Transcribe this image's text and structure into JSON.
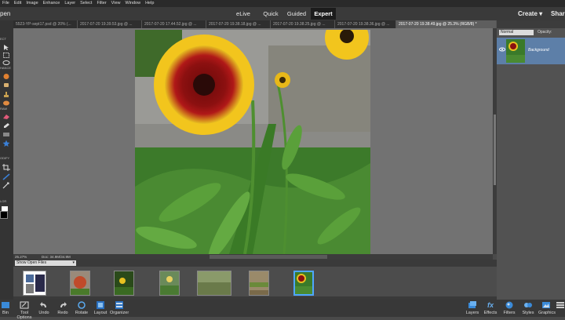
{
  "menu": {
    "items": [
      "File",
      "Edit",
      "Image",
      "Enhance",
      "Layer",
      "Select",
      "Filter",
      "View",
      "Window",
      "Help"
    ]
  },
  "modebar": {
    "open_label": "pen",
    "tabs": [
      "eLive",
      "Quick",
      "Guided",
      "Expert"
    ],
    "active_tab": "Expert",
    "create_label": "Create",
    "share_label": "Share"
  },
  "doc_tabs": [
    {
      "label": "5523-YP-sept17.psd @ 20% (..."
    },
    {
      "label": "2017-07-20 19.39.53.jpg @ ..."
    },
    {
      "label": "2017-07-20 17.44.52.jpg @ ..."
    },
    {
      "label": "2017-07-20 19.38.18.jpg @ ..."
    },
    {
      "label": "2017-07-20 19.38.25.jpg @ ..."
    },
    {
      "label": "2017-07-20 19.38.36.jpg @ ..."
    },
    {
      "label": "2017-07-20 19.38.49.jpg @ 25.3% (RGB/8) *"
    }
  ],
  "toolbar": {
    "sections": [
      "ECT",
      "HANCE",
      "RAW",
      "ODIFY",
      "LOR"
    ]
  },
  "status": {
    "zoom": "25.27%",
    "doc": "Doc: 34.9M/34.9M"
  },
  "photo_bin": {
    "dropdown_label": "Show Open Files",
    "thumb_count": 7,
    "selected_index": 6
  },
  "layers_panel": {
    "blend_mode": "Normal",
    "opacity_label": "Opacity:",
    "layer_name": "Background"
  },
  "bottom_bar": {
    "left": [
      {
        "label": "Bin",
        "icon": "photo-bin-icon"
      },
      {
        "label": "Tool Options",
        "icon": "tool-options-icon"
      },
      {
        "label": "Undo",
        "icon": "undo-icon"
      },
      {
        "label": "Redo",
        "icon": "redo-icon"
      },
      {
        "label": "Rotate",
        "icon": "rotate-icon"
      },
      {
        "label": "Layout",
        "icon": "layout-icon"
      },
      {
        "label": "Organizer",
        "icon": "organizer-icon"
      }
    ],
    "right": [
      {
        "label": "Layers",
        "icon": "layers-icon"
      },
      {
        "label": "Effects",
        "icon": "effects-icon"
      },
      {
        "label": "Filters",
        "icon": "filters-icon"
      },
      {
        "label": "Styles",
        "icon": "styles-icon"
      },
      {
        "label": "Graphics",
        "icon": "graphics-icon"
      },
      {
        "label": "",
        "icon": "more-icon"
      }
    ]
  },
  "colors": {
    "accent": "#4ea6ff",
    "active_tab_bg": "#1c1c1c",
    "selected_layer": "#5d7fa8"
  }
}
